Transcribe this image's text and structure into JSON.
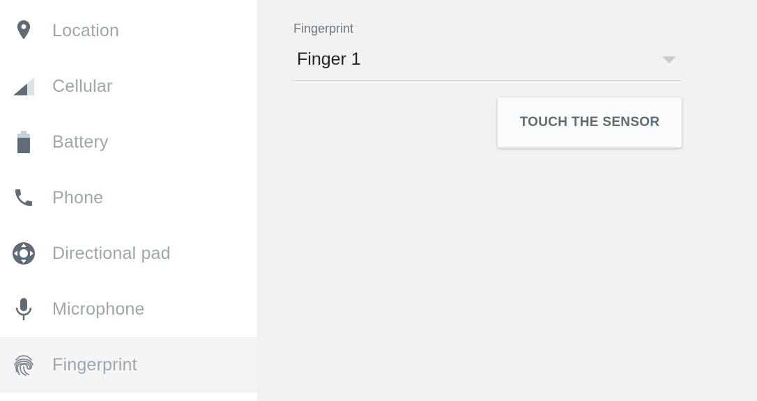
{
  "sidebar": {
    "items": [
      {
        "label": "Location",
        "icon": "location-pin-icon"
      },
      {
        "label": "Cellular",
        "icon": "cellular-signal-icon"
      },
      {
        "label": "Battery",
        "icon": "battery-icon"
      },
      {
        "label": "Phone",
        "icon": "phone-icon"
      },
      {
        "label": "Directional pad",
        "icon": "directional-pad-icon"
      },
      {
        "label": "Microphone",
        "icon": "microphone-icon"
      },
      {
        "label": "Fingerprint",
        "icon": "fingerprint-icon",
        "active": true
      }
    ]
  },
  "main": {
    "fingerprint_label": "Fingerprint",
    "selected_finger": "Finger 1",
    "touch_button_label": "TOUCH THE SENSOR"
  },
  "colors": {
    "icon": "#5f6c77",
    "label": "#9ea6ad",
    "panel_bg": "#f2f2f2",
    "sidebar_bg": "#ffffff"
  }
}
